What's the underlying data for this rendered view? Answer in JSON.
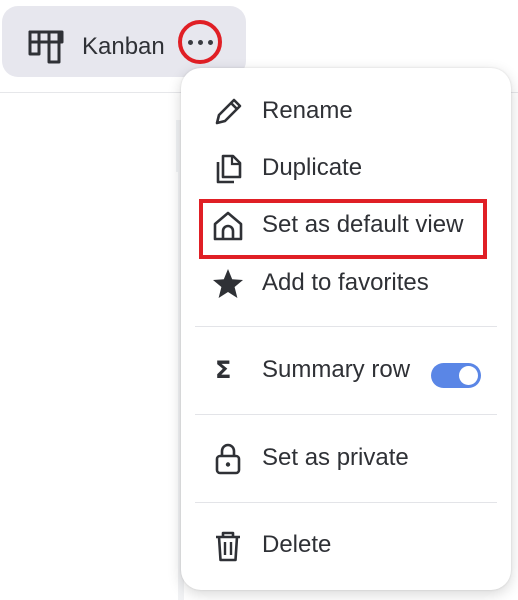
{
  "view_tab": {
    "icon": "kanban-icon",
    "label": "Kanban",
    "more_icon": "more-horizontal-icon"
  },
  "menu": {
    "items": [
      {
        "label": "Rename",
        "icon": "pencil-icon"
      },
      {
        "label": "Duplicate",
        "icon": "copy-icon"
      },
      {
        "label": "Set as default view",
        "icon": "home-icon"
      },
      {
        "label": "Add to favorites",
        "icon": "star-icon"
      },
      {
        "label": "Summary row",
        "icon": "sigma-icon",
        "toggle": true,
        "toggle_on": true
      },
      {
        "label": "Set as private",
        "icon": "lock-icon"
      },
      {
        "label": "Delete",
        "icon": "trash-icon"
      }
    ]
  },
  "colors": {
    "highlight": "#e01f25",
    "toggle_on": "#5a86e6",
    "tab_bg": "#e7e7ee"
  }
}
